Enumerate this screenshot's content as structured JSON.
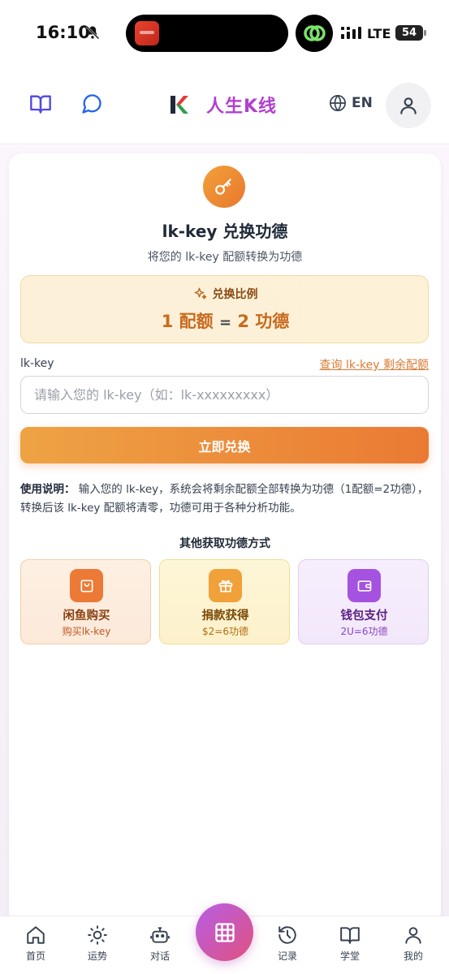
{
  "status_bar": {
    "time": "16:10",
    "network": "LTE",
    "battery": "54"
  },
  "header": {
    "brand_name": "人生K线",
    "language": "EN",
    "icons": {
      "left1": "book-open-icon",
      "left2": "chat-bubble-icon",
      "lang": "globe-icon",
      "profile": "user-icon"
    },
    "brand_colors": {
      "k_dark": "#1f2937",
      "k_red": "#e53935",
      "k_green": "#2e9e4f",
      "name": "#b23fd0"
    }
  },
  "redeem": {
    "title": "lk-key 兑换功德",
    "subtitle": "将您的 lk-key 配额转换为功德",
    "ratio_label": "兑换比例",
    "ratio_left": "1 配额",
    "ratio_eq": "=",
    "ratio_right": "2 功德",
    "field_label": "lk-key",
    "query_link": "查询 lk-key 剩余配额",
    "input_value": "",
    "input_placeholder": "请输入您的 lk-key（如：lk-xxxxxxxxx）",
    "submit_label": "立即兑换",
    "usage_title": "使用说明：",
    "usage_text": "输入您的 lk-key，系统会将剩余配额全部转换为功德（1配额=2功德），转换后该 lk-key 配额将清零，功德可用于各种分析功能。"
  },
  "other_methods": {
    "title": "其他获取功德方式",
    "items": [
      {
        "name": "闲鱼购买",
        "desc": "购买lk-key",
        "icon": "shopping-bag-icon",
        "color": "#ec7a36"
      },
      {
        "name": "捐款获得",
        "desc": "$2=6功德",
        "icon": "gift-icon",
        "color": "#f0a13a"
      },
      {
        "name": "钱包支付",
        "desc": "2U=6功德",
        "icon": "wallet-icon",
        "color": "#a552e0"
      }
    ]
  },
  "bottom_nav": {
    "items": [
      {
        "label": "首页",
        "icon": "home-icon"
      },
      {
        "label": "运势",
        "icon": "sun-icon"
      },
      {
        "label": "对话",
        "icon": "robot-icon"
      },
      {
        "label": "记录",
        "icon": "history-icon"
      },
      {
        "label": "学堂",
        "icon": "book-open-icon"
      },
      {
        "label": "我的",
        "icon": "user-icon"
      }
    ],
    "center_icon": "grid-icon"
  }
}
